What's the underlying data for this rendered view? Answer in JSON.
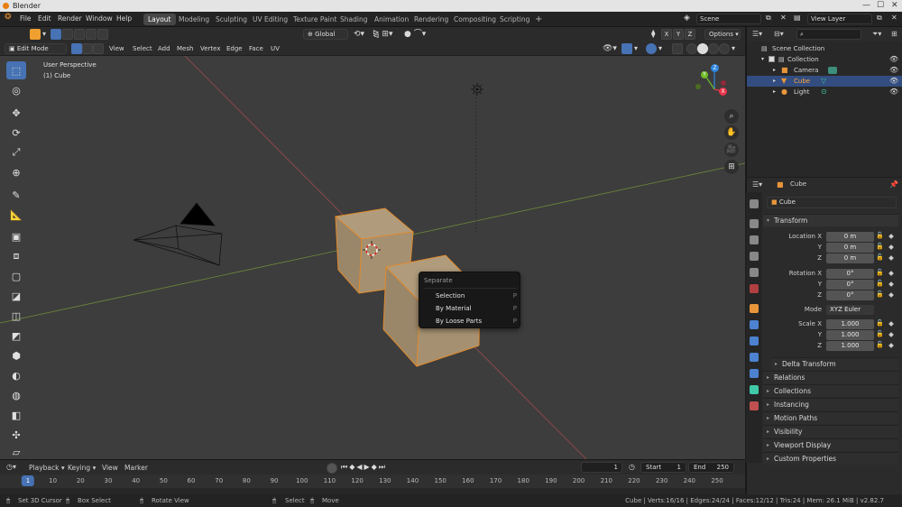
{
  "window": {
    "title": "Blender"
  },
  "menu": [
    "File",
    "Edit",
    "Render",
    "Window",
    "Help"
  ],
  "workspaces": [
    "Layout",
    "Modeling",
    "Sculpting",
    "UV Editing",
    "Texture Paint",
    "Shading",
    "Animation",
    "Rendering",
    "Compositing",
    "Scripting",
    "+"
  ],
  "scene": {
    "name": "Scene",
    "view_layer": "View Layer"
  },
  "header": {
    "mode": "Edit Mode",
    "menus": [
      "View",
      "Select",
      "Add",
      "Mesh",
      "Vertex",
      "Edge",
      "Face",
      "UV"
    ],
    "transform_orientation": "Global",
    "axes": [
      "X",
      "Y",
      "Z"
    ],
    "options": "Options"
  },
  "viewport": {
    "view_name": "User Perspective",
    "object_name": "(1) Cube"
  },
  "gizmo": {
    "colors": {
      "x": "#e8334a",
      "y": "#6ebc28",
      "z": "#2f86e0"
    },
    "labels": {
      "x": "X",
      "y": "Y",
      "z": "Z"
    }
  },
  "context_menu": {
    "title": "Separate",
    "items": [
      {
        "label": "Selection",
        "key": "P"
      },
      {
        "label": "By Material",
        "key": "P"
      },
      {
        "label": "By Loose Parts",
        "key": "P"
      }
    ]
  },
  "outliner": {
    "rows": [
      {
        "label": "Scene Collection"
      },
      {
        "label": "Collection"
      },
      {
        "label": "Camera"
      },
      {
        "label": "Cube"
      },
      {
        "label": "Light"
      }
    ]
  },
  "properties": {
    "object_name": "Cube",
    "name_field": "Cube",
    "transform_label": "Transform",
    "location": {
      "label": "Location X",
      "x": "0 m",
      "y": "0 m",
      "z": "0 m"
    },
    "rotation": {
      "label": "Rotation X",
      "x": "0°",
      "y": "0°",
      "z": "0°"
    },
    "mode": {
      "label": "Mode",
      "value": "XYZ Euler"
    },
    "scale": {
      "label": "Scale X",
      "x": "1.000",
      "y": "1.000",
      "z": "1.000"
    },
    "axis_y": "Y",
    "axis_z": "Z",
    "sections": [
      "Delta Transform",
      "Relations",
      "Collections",
      "Instancing",
      "Motion Paths",
      "Visibility",
      "Viewport Display",
      "Custom Properties"
    ]
  },
  "timeline": {
    "menus": [
      "Playback",
      "Keying",
      "View",
      "Marker"
    ],
    "current_frame": "1",
    "start_label": "Start",
    "start": "1",
    "end_label": "End",
    "end": "250",
    "ticks": [
      "1",
      "10",
      "20",
      "30",
      "40",
      "50",
      "60",
      "70",
      "80",
      "90",
      "100",
      "110",
      "120",
      "130",
      "140",
      "150",
      "160",
      "170",
      "180",
      "190",
      "200",
      "210",
      "220",
      "230",
      "240",
      "250"
    ]
  },
  "status": {
    "left": [
      "Set 3D Cursor",
      "Box Select",
      "Rotate View",
      "Select",
      "Move"
    ],
    "right": "Cube | Verts:16/16 | Edges:24/24 | Faces:12/12 | Tris:24 | Mem: 26.1 MiB | v2.82.7"
  }
}
